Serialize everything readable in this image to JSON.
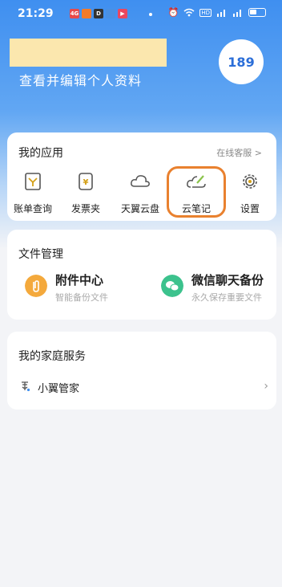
{
  "status_bar": {
    "time": "21:29",
    "left_icons": [
      {
        "name": "app-notification-icon-1",
        "text": "4G",
        "color": "#e84a4a"
      },
      {
        "name": "app-notification-icon-2",
        "text": "",
        "color": "#f27b2a"
      },
      {
        "name": "app-notification-icon-3",
        "text": "D",
        "color": "#333333"
      },
      {
        "name": "app-notification-icon-4",
        "text": "",
        "color": "#4a90e2"
      },
      {
        "name": "app-notification-icon-5",
        "text": "▶",
        "color": "#e9475f"
      }
    ],
    "right_icons": [
      "alarm-icon",
      "wifi-icon",
      "hd-icon",
      "signal-icon",
      "signal-icon",
      "battery-icon"
    ]
  },
  "profile": {
    "subtitle": "查看并编辑个人资料",
    "badge_value": "189"
  },
  "my_apps": {
    "title": "我的应用",
    "service_link": "在线客服 >",
    "items": [
      {
        "label": "账单查询",
        "icon": "bill-icon"
      },
      {
        "label": "发票夹",
        "icon": "invoice-folder-icon"
      },
      {
        "label": "天翼云盘",
        "icon": "cloud-disk-icon"
      },
      {
        "label": "云笔记",
        "icon": "cloud-note-icon"
      },
      {
        "label": "设置",
        "icon": "gear-icon"
      }
    ]
  },
  "file_management": {
    "title": "文件管理",
    "items": [
      {
        "name": "附件中心",
        "desc": "智能备份文件",
        "icon": "attachment-icon",
        "color": "#f4a93c"
      },
      {
        "name": "微信聊天备份",
        "desc": "永久保存重要文件",
        "icon": "wechat-icon",
        "color": "#3cc28d"
      }
    ]
  },
  "family_services": {
    "title": "我的家庭服务",
    "items": [
      {
        "label": "小翼管家",
        "icon": "xiaoyi-butler-icon"
      }
    ]
  },
  "colors": {
    "accent_blue": "#3f8ff0",
    "highlight_orange": "#e9812f"
  }
}
